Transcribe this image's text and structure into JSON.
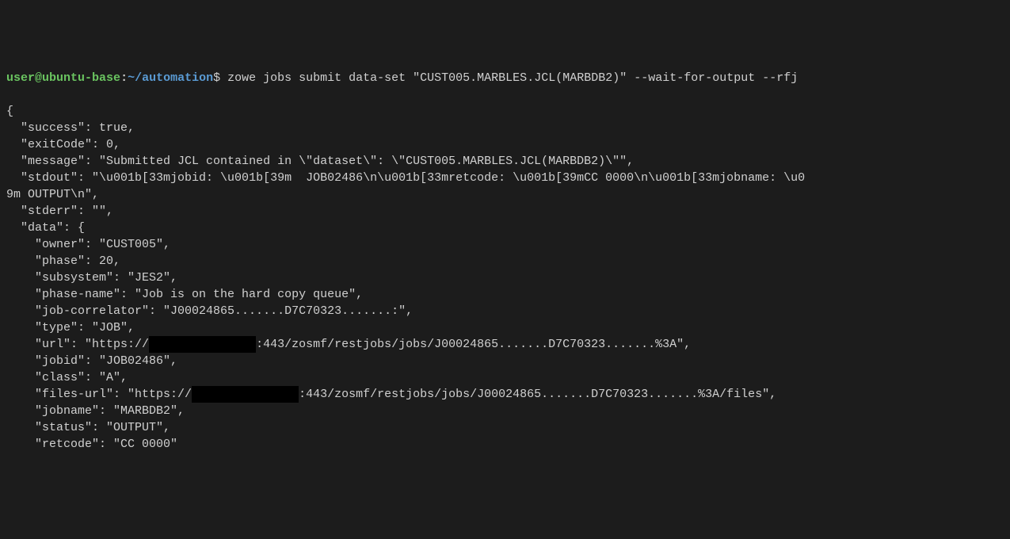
{
  "prompt": {
    "user": "user",
    "at": "@",
    "host": "ubuntu-base",
    "colon": ":",
    "path": "~/automation",
    "dollar": "$"
  },
  "command": " zowe jobs submit data-set \"CUST005.MARBLES.JCL(MARBDB2)\" --wait-for-output --rfj",
  "output_lines": {
    "l0": "{",
    "l1": "  \"success\": true,",
    "l2": "  \"exitCode\": 0,",
    "l3": "  \"message\": \"Submitted JCL contained in \\\"dataset\\\": \\\"CUST005.MARBLES.JCL(MARBDB2)\\\"\",",
    "l4": "  \"stdout\": \"\\u001b[33mjobid: \\u001b[39m  JOB02486\\n\\u001b[33mretcode: \\u001b[39mCC 0000\\n\\u001b[33mjobname: \\u0",
    "l5": "9m OUTPUT\\n\",",
    "l6": "  \"stderr\": \"\",",
    "l7": "  \"data\": {",
    "l8": "    \"owner\": \"CUST005\",",
    "l9": "    \"phase\": 20,",
    "l10": "    \"subsystem\": \"JES2\",",
    "l11": "    \"phase-name\": \"Job is on the hard copy queue\",",
    "l12": "    \"job-correlator\": \"J00024865.......D7C70323.......:\",",
    "l13": "    \"type\": \"JOB\",",
    "l14a": "    \"url\": \"https://",
    "l14_redacted": "               ",
    "l14b": ":443/zosmf/restjobs/jobs/J00024865.......D7C70323.......%3A\",",
    "l15": "    \"jobid\": \"JOB02486\",",
    "l16": "    \"class\": \"A\",",
    "l17a": "    \"files-url\": \"https://",
    "l17_redacted": "               ",
    "l17b": ":443/zosmf/restjobs/jobs/J00024865.......D7C70323.......%3A/files\",",
    "l18": "    \"jobname\": \"MARBDB2\",",
    "l19": "    \"status\": \"OUTPUT\",",
    "l20": "    \"retcode\": \"CC 0000\""
  }
}
